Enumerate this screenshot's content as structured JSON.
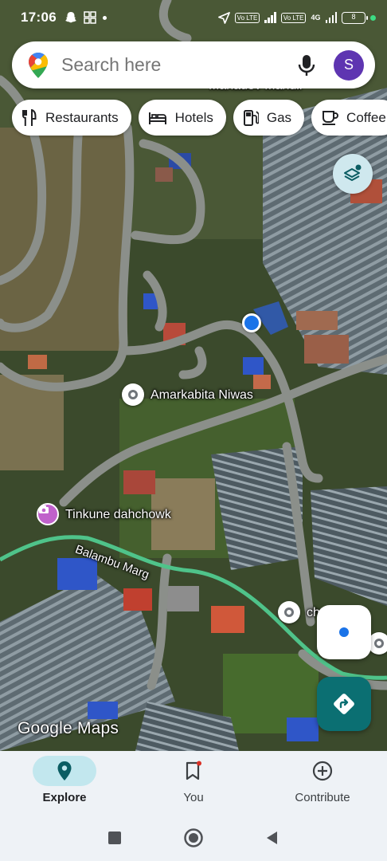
{
  "status_bar": {
    "time": "17:06",
    "network": "4G",
    "battery": "8",
    "volte_1": "Vo LTE",
    "volte_2": "Vo LTE"
  },
  "search": {
    "placeholder": "Search here",
    "avatar_letter": "S"
  },
  "chips": [
    {
      "label": "Restaurants",
      "icon": "fork-knife-icon"
    },
    {
      "label": "Hotels",
      "icon": "bed-icon"
    },
    {
      "label": "Gas",
      "icon": "gas-pump-icon"
    },
    {
      "label": "Coffee",
      "icon": "coffee-icon"
    }
  ],
  "map": {
    "labels": {
      "top_partial": "Mahadev Mandir",
      "amarkabita": "Amarkabita Niwas",
      "tinkune": "Tinkune dahchowk",
      "road": "Balambu Marg",
      "partial_right": "ch   epa"
    },
    "watermark": "Google Maps"
  },
  "nav": {
    "explore": "Explore",
    "you": "You",
    "contribute": "Contribute"
  },
  "colors": {
    "accent_teal": "#0b6f72",
    "explore_active_bg": "#c2e7ee",
    "location_blue": "#1a73e8",
    "route_green": "#4fc38a",
    "avatar_purple": "#5e35b1"
  }
}
